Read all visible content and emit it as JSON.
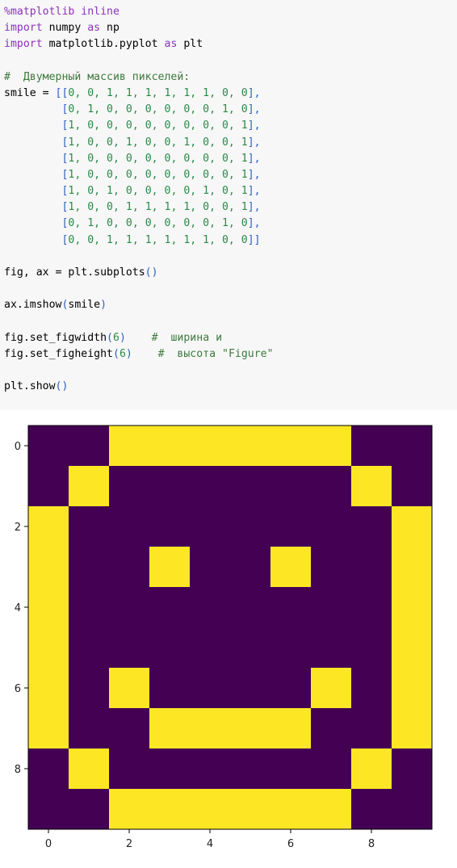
{
  "code_cell": {
    "lines": [
      [
        {
          "t": "%matplotlib inline",
          "c": "kw"
        }
      ],
      [
        {
          "t": "import",
          "c": "kw"
        },
        {
          "t": " numpy ",
          "c": ""
        },
        {
          "t": "as",
          "c": "kw"
        },
        {
          "t": " np",
          "c": ""
        }
      ],
      [
        {
          "t": "import",
          "c": "kw"
        },
        {
          "t": " matplotlib.pyplot ",
          "c": ""
        },
        {
          "t": "as",
          "c": "kw"
        },
        {
          "t": " plt",
          "c": ""
        }
      ],
      [
        {
          "t": "",
          "c": ""
        }
      ],
      [
        {
          "t": "#  Двумерный массив пикселей:",
          "c": "cm"
        }
      ],
      [
        {
          "t": "smile = ",
          "c": ""
        },
        {
          "t": "[[",
          "c": "br"
        },
        {
          "t": "0, 0, 1, 1, 1, 1, 1, 1, 0, 0",
          "c": "num"
        },
        {
          "t": "],",
          "c": "br"
        }
      ],
      [
        {
          "t": "         ",
          "c": ""
        },
        {
          "t": "[",
          "c": "br"
        },
        {
          "t": "0, 1, 0, 0, 0, 0, 0, 0, 1, 0",
          "c": "num"
        },
        {
          "t": "],",
          "c": "br"
        }
      ],
      [
        {
          "t": "         ",
          "c": ""
        },
        {
          "t": "[",
          "c": "br"
        },
        {
          "t": "1, 0, 0, 0, 0, 0, 0, 0, 0, 1",
          "c": "num"
        },
        {
          "t": "],",
          "c": "br"
        }
      ],
      [
        {
          "t": "         ",
          "c": ""
        },
        {
          "t": "[",
          "c": "br"
        },
        {
          "t": "1, 0, 0, 1, 0, 0, 1, 0, 0, 1",
          "c": "num"
        },
        {
          "t": "],",
          "c": "br"
        }
      ],
      [
        {
          "t": "         ",
          "c": ""
        },
        {
          "t": "[",
          "c": "br"
        },
        {
          "t": "1, 0, 0, 0, 0, 0, 0, 0, 0, 1",
          "c": "num"
        },
        {
          "t": "],",
          "c": "br"
        }
      ],
      [
        {
          "t": "         ",
          "c": ""
        },
        {
          "t": "[",
          "c": "br"
        },
        {
          "t": "1, 0, 0, 0, 0, 0, 0, 0, 0, 1",
          "c": "num"
        },
        {
          "t": "],",
          "c": "br"
        }
      ],
      [
        {
          "t": "         ",
          "c": ""
        },
        {
          "t": "[",
          "c": "br"
        },
        {
          "t": "1, 0, 1, 0, 0, 0, 0, 1, 0, 1",
          "c": "num"
        },
        {
          "t": "],",
          "c": "br"
        }
      ],
      [
        {
          "t": "         ",
          "c": ""
        },
        {
          "t": "[",
          "c": "br"
        },
        {
          "t": "1, 0, 0, 1, 1, 1, 1, 0, 0, 1",
          "c": "num"
        },
        {
          "t": "],",
          "c": "br"
        }
      ],
      [
        {
          "t": "         ",
          "c": ""
        },
        {
          "t": "[",
          "c": "br"
        },
        {
          "t": "0, 1, 0, 0, 0, 0, 0, 0, 1, 0",
          "c": "num"
        },
        {
          "t": "],",
          "c": "br"
        }
      ],
      [
        {
          "t": "         ",
          "c": ""
        },
        {
          "t": "[",
          "c": "br"
        },
        {
          "t": "0, 0, 1, 1, 1, 1, 1, 1, 0, 0",
          "c": "num"
        },
        {
          "t": "]]",
          "c": "br"
        }
      ],
      [
        {
          "t": "",
          "c": ""
        }
      ],
      [
        {
          "t": "fig, ax = plt.subplots",
          "c": ""
        },
        {
          "t": "()",
          "c": "br"
        }
      ],
      [
        {
          "t": "",
          "c": ""
        }
      ],
      [
        {
          "t": "ax.imshow",
          "c": ""
        },
        {
          "t": "(",
          "c": "br"
        },
        {
          "t": "smile",
          "c": ""
        },
        {
          "t": ")",
          "c": "br"
        }
      ],
      [
        {
          "t": "",
          "c": ""
        }
      ],
      [
        {
          "t": "fig.set_figwidth",
          "c": ""
        },
        {
          "t": "(",
          "c": "br"
        },
        {
          "t": "6",
          "c": "num"
        },
        {
          "t": ")",
          "c": "br"
        },
        {
          "t": "    ",
          "c": ""
        },
        {
          "t": "#  ширина и",
          "c": "cm"
        }
      ],
      [
        {
          "t": "fig.set_figheight",
          "c": ""
        },
        {
          "t": "(",
          "c": "br"
        },
        {
          "t": "6",
          "c": "num"
        },
        {
          "t": ")",
          "c": "br"
        },
        {
          "t": "    ",
          "c": ""
        },
        {
          "t": "#  высота ",
          "c": "cm"
        },
        {
          "t": "\"Figure\"",
          "c": "cm"
        }
      ],
      [
        {
          "t": "",
          "c": ""
        }
      ],
      [
        {
          "t": "plt.show",
          "c": ""
        },
        {
          "t": "()",
          "c": "br"
        }
      ]
    ]
  },
  "colors": {
    "low": "#440154",
    "high": "#fde725",
    "code_bg": "#f7f7f7"
  },
  "chart_data": {
    "type": "heatmap",
    "rows": 10,
    "cols": 10,
    "values": [
      [
        0,
        0,
        1,
        1,
        1,
        1,
        1,
        1,
        0,
        0
      ],
      [
        0,
        1,
        0,
        0,
        0,
        0,
        0,
        0,
        1,
        0
      ],
      [
        1,
        0,
        0,
        0,
        0,
        0,
        0,
        0,
        0,
        1
      ],
      [
        1,
        0,
        0,
        1,
        0,
        0,
        1,
        0,
        0,
        1
      ],
      [
        1,
        0,
        0,
        0,
        0,
        0,
        0,
        0,
        0,
        1
      ],
      [
        1,
        0,
        0,
        0,
        0,
        0,
        0,
        0,
        0,
        1
      ],
      [
        1,
        0,
        1,
        0,
        0,
        0,
        0,
        1,
        0,
        1
      ],
      [
        1,
        0,
        0,
        1,
        1,
        1,
        1,
        0,
        0,
        1
      ],
      [
        0,
        1,
        0,
        0,
        0,
        0,
        0,
        0,
        1,
        0
      ],
      [
        0,
        0,
        1,
        1,
        1,
        1,
        1,
        1,
        0,
        0
      ]
    ],
    "x_ticks": [
      "0",
      "2",
      "4",
      "6",
      "8"
    ],
    "y_ticks": [
      "0",
      "2",
      "4",
      "6",
      "8"
    ],
    "x_tick_values": [
      0,
      2,
      4,
      6,
      8
    ],
    "y_tick_values": [
      0,
      2,
      4,
      6,
      8
    ],
    "colormap": "viridis",
    "grid": false
  }
}
